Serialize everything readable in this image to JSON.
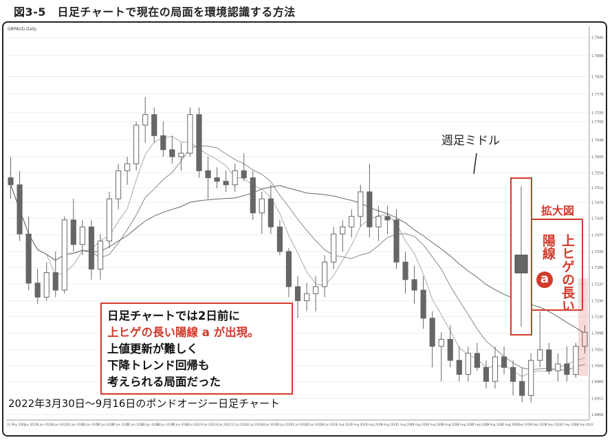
{
  "figure_title": "図3-5　日足チャートで現在の局面を環境認識する方法",
  "symbol_label": "GBPAUD,Daily",
  "annotations": {
    "kakudai": "拡大図",
    "yosen": "陽線",
    "uehige": "上ヒゲの長い",
    "badge": "a",
    "weekly_mid": "週足ミドル"
  },
  "note": {
    "line1": "日足チャートでは2日前に",
    "line2": "上ヒゲの長い陽線 a が出現。",
    "line3": "上値更新が難しく",
    "line4": "下降トレンド回帰も",
    "line5": "考えられる局面だった"
  },
  "caption": "2022年3月30日〜9月16日のポンドオージー日足チャート",
  "colors": {
    "candle_up": "#ffffff",
    "candle_down": "#666666",
    "accent": "#d23a2c",
    "line": "#888888"
  },
  "chart_data": {
    "type": "candlestick",
    "ylim": [
      1.685,
      1.797
    ],
    "y_ticks": [
      1.794,
      1.7888,
      1.7828,
      1.7778,
      1.7725,
      1.77,
      1.7648,
      1.76,
      1.7554,
      1.7512,
      1.747,
      1.7425,
      1.7377,
      1.733,
      1.7285,
      1.7237,
      1.719,
      1.7145,
      1.7098,
      1.7051,
      1.7005,
      1.696,
      1.6912,
      1.6866
    ],
    "x_ticks": [
      "31 May 2022",
      "2 Jun 2022",
      "6 Jun 2022",
      "8 Jun 2022",
      "10 Jun 2022",
      "14 Jun 2022",
      "16 Jun 2022",
      "20 Jun 2022",
      "22 Jun 2022",
      "24 Jun 2022",
      "28 Jun 2022",
      "30 Jun 2022",
      "4 Jul 2022",
      "6 Jul 2022",
      "8 Jul 2022",
      "12 Jul 2022",
      "14 Jul 2022",
      "18 Jul 2022",
      "20 Jul 2022",
      "22 Jul 2022",
      "26 Jul 2022",
      "28 Jul 2022",
      "1 Aug 2022",
      "3 Aug 2022",
      "5 Aug 2022",
      "9 Aug 2022",
      "11 Aug 2022",
      "15 Aug 2022",
      "17 Aug 2022",
      "19 Aug 2022",
      "23 Aug 2022",
      "25 Aug 2022",
      "29 Aug 2022",
      "31 Aug 2022",
      "2 Sep 2022",
      "6 Sep 2022",
      "8 Sep 2022",
      "12 Sep 2022",
      "14 Sep 2022"
    ],
    "candles": [
      [
        1.754,
        1.76,
        1.748,
        1.752
      ],
      [
        1.752,
        1.756,
        1.736,
        1.738
      ],
      [
        1.738,
        1.743,
        1.722,
        1.724
      ],
      [
        1.724,
        1.728,
        1.718,
        1.72
      ],
      [
        1.72,
        1.73,
        1.719,
        1.727
      ],
      [
        1.727,
        1.733,
        1.72,
        1.722
      ],
      [
        1.722,
        1.743,
        1.721,
        1.742
      ],
      [
        1.742,
        1.748,
        1.733,
        1.735
      ],
      [
        1.735,
        1.742,
        1.732,
        1.74
      ],
      [
        1.74,
        1.742,
        1.725,
        1.728
      ],
      [
        1.728,
        1.738,
        1.725,
        1.736
      ],
      [
        1.736,
        1.75,
        1.734,
        1.748
      ],
      [
        1.748,
        1.758,
        1.745,
        1.756
      ],
      [
        1.756,
        1.76,
        1.752,
        1.758
      ],
      [
        1.758,
        1.77,
        1.756,
        1.769
      ],
      [
        1.769,
        1.777,
        1.764,
        1.772
      ],
      [
        1.772,
        1.774,
        1.764,
        1.766
      ],
      [
        1.766,
        1.77,
        1.76,
        1.762
      ],
      [
        1.762,
        1.766,
        1.758,
        1.76
      ],
      [
        1.76,
        1.764,
        1.756,
        1.761
      ],
      [
        1.761,
        1.774,
        1.76,
        1.772
      ],
      [
        1.772,
        1.774,
        1.754,
        1.756
      ],
      [
        1.756,
        1.76,
        1.748,
        1.754
      ],
      [
        1.754,
        1.757,
        1.751,
        1.753
      ],
      [
        1.753,
        1.756,
        1.75,
        1.752
      ],
      [
        1.752,
        1.758,
        1.75,
        1.756
      ],
      [
        1.756,
        1.761,
        1.753,
        1.754
      ],
      [
        1.754,
        1.756,
        1.742,
        1.744
      ],
      [
        1.744,
        1.75,
        1.738,
        1.748
      ],
      [
        1.748,
        1.752,
        1.738,
        1.74
      ],
      [
        1.74,
        1.742,
        1.732,
        1.733
      ],
      [
        1.733,
        1.734,
        1.72,
        1.723
      ],
      [
        1.723,
        1.726,
        1.714,
        1.719
      ],
      [
        1.719,
        1.724,
        1.716,
        1.721
      ],
      [
        1.721,
        1.726,
        1.716,
        1.723
      ],
      [
        1.723,
        1.732,
        1.72,
        1.73
      ],
      [
        1.73,
        1.74,
        1.728,
        1.738
      ],
      [
        1.738,
        1.742,
        1.733,
        1.74
      ],
      [
        1.74,
        1.745,
        1.737,
        1.743
      ],
      [
        1.743,
        1.752,
        1.74,
        1.75
      ],
      [
        1.75,
        1.758,
        1.737,
        1.74
      ],
      [
        1.74,
        1.746,
        1.736,
        1.743
      ],
      [
        1.743,
        1.746,
        1.738,
        1.742
      ],
      [
        1.742,
        1.745,
        1.728,
        1.73
      ],
      [
        1.73,
        1.733,
        1.721,
        1.725
      ],
      [
        1.725,
        1.729,
        1.718,
        1.722
      ],
      [
        1.722,
        1.726,
        1.711,
        1.714
      ],
      [
        1.714,
        1.716,
        1.7,
        1.706
      ],
      [
        1.706,
        1.71,
        1.696,
        1.708
      ],
      [
        1.708,
        1.712,
        1.7,
        1.702
      ],
      [
        1.702,
        1.706,
        1.696,
        1.698
      ],
      [
        1.698,
        1.706,
        1.696,
        1.704
      ],
      [
        1.704,
        1.707,
        1.699,
        1.7
      ],
      [
        1.7,
        1.702,
        1.694,
        1.696
      ],
      [
        1.696,
        1.706,
        1.694,
        1.703
      ],
      [
        1.703,
        1.706,
        1.698,
        1.7
      ],
      [
        1.7,
        1.702,
        1.692,
        1.696
      ],
      [
        1.696,
        1.7,
        1.69,
        1.692
      ],
      [
        1.692,
        1.704,
        1.69,
        1.702
      ],
      [
        1.702,
        1.716,
        1.7,
        1.705
      ],
      [
        1.705,
        1.707,
        1.698,
        1.699
      ],
      [
        1.699,
        1.704,
        1.696,
        1.701
      ],
      [
        1.701,
        1.706,
        1.696,
        1.698
      ],
      [
        1.698,
        1.707,
        1.697,
        1.706
      ],
      [
        1.706,
        1.712,
        1.704,
        1.71
      ]
    ]
  }
}
